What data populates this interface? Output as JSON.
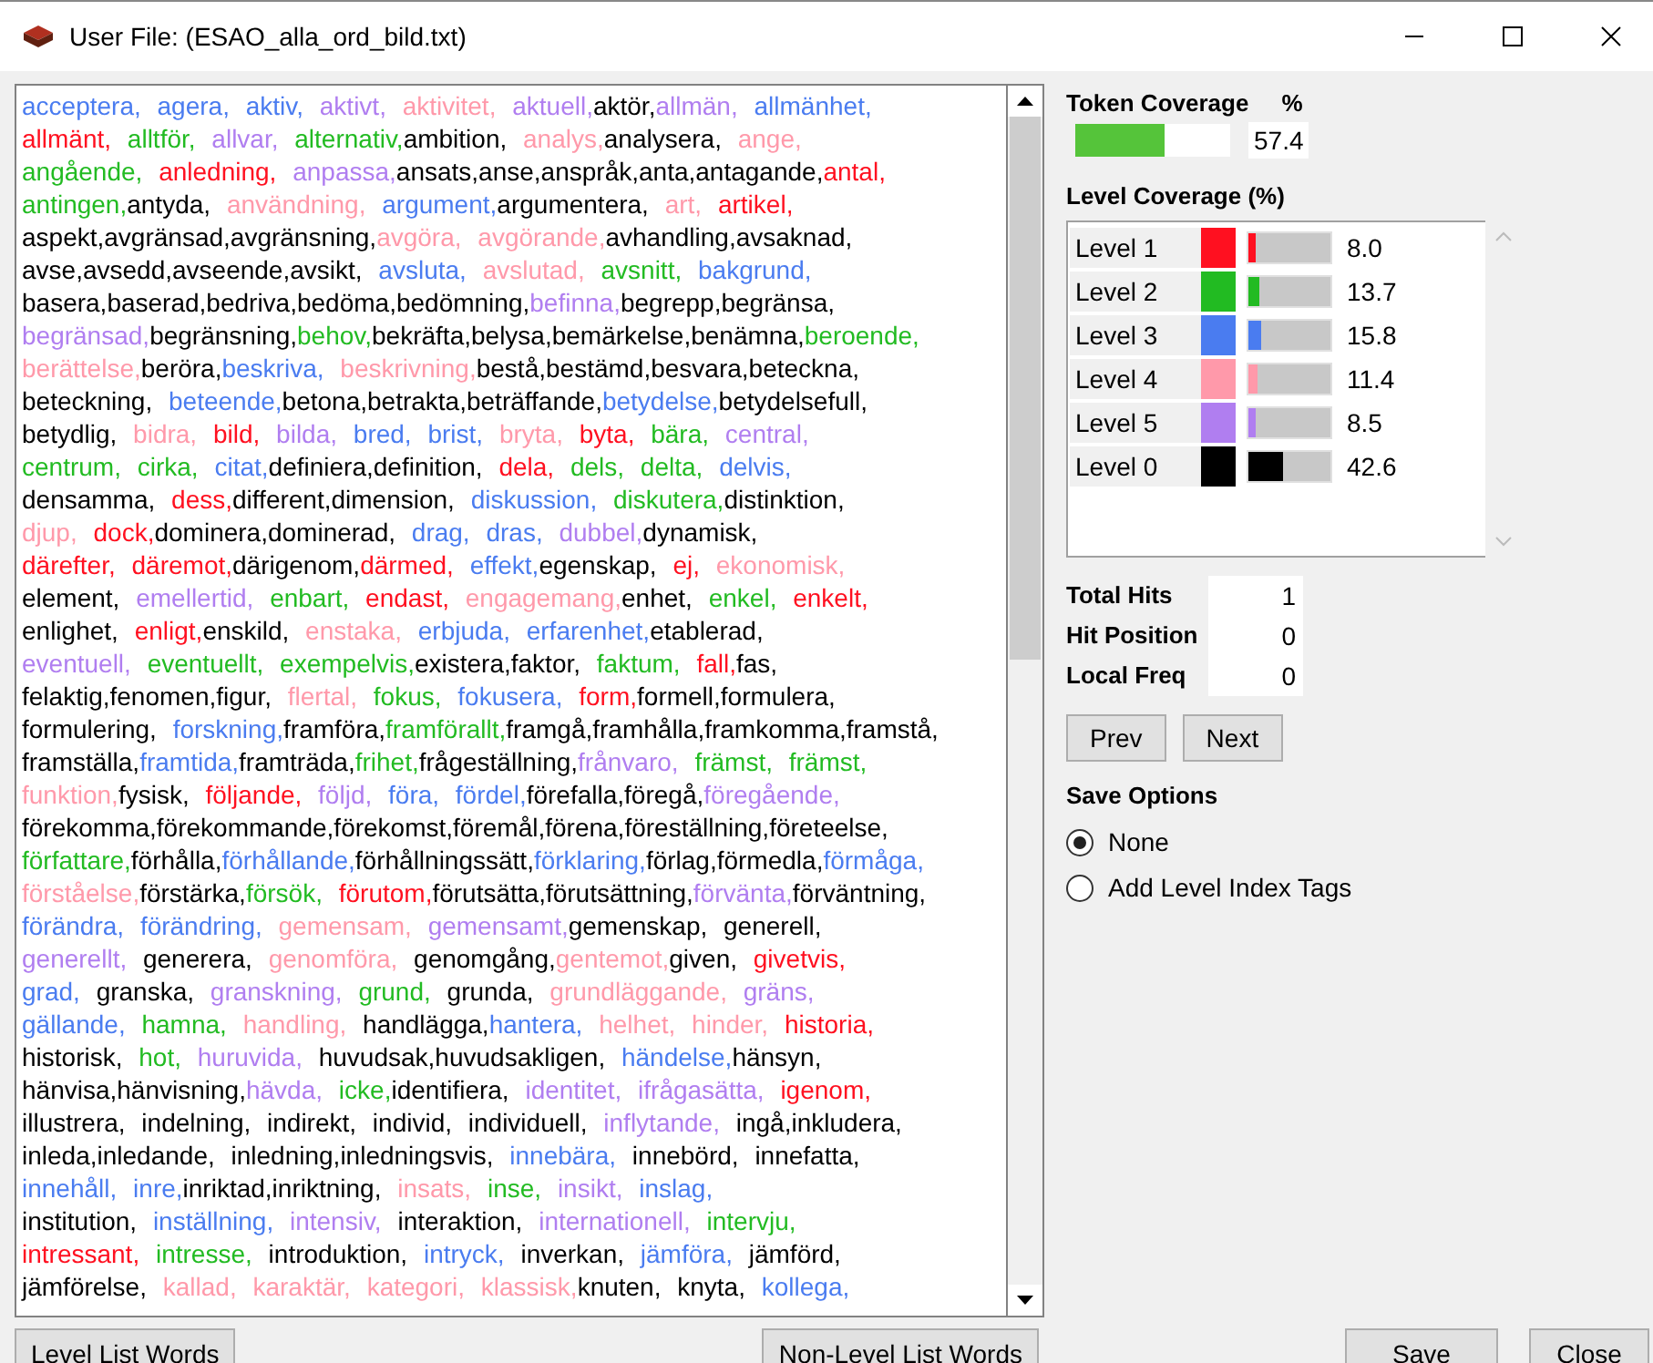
{
  "window": {
    "title": "User File: (ESAO_alla_ord_bild.txt)"
  },
  "words": {
    "lines": [
      [
        {
          "w": "acceptera, ",
          "color": "#4a7cf0"
        },
        {
          "w": "agera, ",
          "color": "#4a7cf0"
        },
        {
          "w": "aktiv, ",
          "color": "#4a7cf0"
        },
        {
          "w": "aktivt, ",
          "color": "#b07ef0"
        },
        {
          "w": "aktivitet, ",
          "color": "#ff99aa"
        },
        {
          "w": "aktuell,",
          "color": "#b07ef0"
        },
        {
          "w": "aktör,",
          "color": "#000000"
        },
        {
          "w": "allmän, ",
          "color": "#b07ef0"
        },
        {
          "w": "allmänhet,",
          "color": "#4a7cf0"
        }
      ],
      [
        {
          "w": "allmänt, ",
          "color": "#ff1020"
        },
        {
          "w": "alltför, ",
          "color": "#22bb22"
        },
        {
          "w": "allvar, ",
          "color": "#b07ef0"
        },
        {
          "w": "alternativ,",
          "color": "#22bb22"
        },
        {
          "w": "ambition, ",
          "color": "#000000"
        },
        {
          "w": "analys,",
          "color": "#ff99aa"
        },
        {
          "w": "analysera, ",
          "color": "#000000"
        },
        {
          "w": "ange,",
          "color": "#ff99aa"
        }
      ],
      [
        {
          "w": "angående, ",
          "color": "#22bb22"
        },
        {
          "w": "anledning, ",
          "color": "#ff1020"
        },
        {
          "w": "anpassa,",
          "color": "#b07ef0"
        },
        {
          "w": "ansats,anse,anspråk,anta,antagande,",
          "color": "#000000"
        },
        {
          "w": "antal,",
          "color": "#ff1020"
        }
      ],
      [
        {
          "w": "antingen,",
          "color": "#22bb22"
        },
        {
          "w": "antyda, ",
          "color": "#000000"
        },
        {
          "w": "användning, ",
          "color": "#ff99aa"
        },
        {
          "w": "argument,",
          "color": "#4a7cf0"
        },
        {
          "w": "argumentera, ",
          "color": "#000000"
        },
        {
          "w": "art, ",
          "color": "#ff99aa"
        },
        {
          "w": "artikel,",
          "color": "#ff1020"
        }
      ],
      [
        {
          "w": "aspekt,avgränsad,avgränsning,",
          "color": "#000000"
        },
        {
          "w": "avgöra, ",
          "color": "#ff99aa"
        },
        {
          "w": "avgörande,",
          "color": "#ff99aa"
        },
        {
          "w": "avhandling,avsaknad,",
          "color": "#000000"
        }
      ],
      [
        {
          "w": "avse,avsedd,avseende,avsikt, ",
          "color": "#000000"
        },
        {
          "w": "avsluta, ",
          "color": "#4a7cf0"
        },
        {
          "w": "avslutad, ",
          "color": "#ff99aa"
        },
        {
          "w": "avsnitt, ",
          "color": "#22bb22"
        },
        {
          "w": "bakgrund,",
          "color": "#4a7cf0"
        }
      ],
      [
        {
          "w": "basera,baserad,bedriva,bedöma,bedömning,",
          "color": "#000000"
        },
        {
          "w": "befinna,",
          "color": "#b07ef0"
        },
        {
          "w": "begrepp,begränsa,",
          "color": "#000000"
        }
      ],
      [
        {
          "w": "begränsad,",
          "color": "#b07ef0"
        },
        {
          "w": "begränsning,",
          "color": "#000000"
        },
        {
          "w": "behov,",
          "color": "#22bb22"
        },
        {
          "w": "bekräfta,belysa,bemärkelse,benämna,",
          "color": "#000000"
        },
        {
          "w": "beroende,",
          "color": "#22bb22"
        }
      ],
      [
        {
          "w": "berättelse,",
          "color": "#ff99aa"
        },
        {
          "w": "beröra,",
          "color": "#000000"
        },
        {
          "w": "beskriva, ",
          "color": "#4a7cf0"
        },
        {
          "w": "beskrivning,",
          "color": "#ff99aa"
        },
        {
          "w": "bestå,bestämd,besvara,beteckna,",
          "color": "#000000"
        }
      ],
      [
        {
          "w": "beteckning, ",
          "color": "#000000"
        },
        {
          "w": "beteende,",
          "color": "#4a7cf0"
        },
        {
          "w": "betona,betrakta,beträffande,",
          "color": "#000000"
        },
        {
          "w": "betydelse,",
          "color": "#4a7cf0"
        },
        {
          "w": "betydelsefull,",
          "color": "#000000"
        }
      ],
      [
        {
          "w": "betydlig, ",
          "color": "#000000"
        },
        {
          "w": "bidra, ",
          "color": "#ff99aa"
        },
        {
          "w": "bild, ",
          "color": "#ff1020"
        },
        {
          "w": "bilda, ",
          "color": "#b07ef0"
        },
        {
          "w": "bred, ",
          "color": "#4a7cf0"
        },
        {
          "w": "brist, ",
          "color": "#4a7cf0"
        },
        {
          "w": "bryta, ",
          "color": "#ff99aa"
        },
        {
          "w": "byta, ",
          "color": "#ff1020"
        },
        {
          "w": "bära, ",
          "color": "#22bb22"
        },
        {
          "w": "central,",
          "color": "#b07ef0"
        }
      ],
      [
        {
          "w": "centrum, ",
          "color": "#22bb22"
        },
        {
          "w": "cirka, ",
          "color": "#22bb22"
        },
        {
          "w": "citat,",
          "color": "#4a7cf0"
        },
        {
          "w": "definiera,definition, ",
          "color": "#000000"
        },
        {
          "w": "dela, ",
          "color": "#ff1020"
        },
        {
          "w": "dels, ",
          "color": "#22bb22"
        },
        {
          "w": "delta, ",
          "color": "#22bb22"
        },
        {
          "w": "delvis,",
          "color": "#4a7cf0"
        }
      ],
      [
        {
          "w": "densamma, ",
          "color": "#000000"
        },
        {
          "w": "dess,",
          "color": "#ff1020"
        },
        {
          "w": "different,dimension, ",
          "color": "#000000"
        },
        {
          "w": "diskussion, ",
          "color": "#4a7cf0"
        },
        {
          "w": "diskutera,",
          "color": "#22bb22"
        },
        {
          "w": "distinktion,",
          "color": "#000000"
        }
      ],
      [
        {
          "w": "djup, ",
          "color": "#ff99aa"
        },
        {
          "w": "dock,",
          "color": "#ff1020"
        },
        {
          "w": "dominera,dominerad, ",
          "color": "#000000"
        },
        {
          "w": "drag, ",
          "color": "#4a7cf0"
        },
        {
          "w": "dras, ",
          "color": "#4a7cf0"
        },
        {
          "w": "dubbel,",
          "color": "#b07ef0"
        },
        {
          "w": "dynamisk,",
          "color": "#000000"
        }
      ],
      [
        {
          "w": "därefter, ",
          "color": "#ff1020"
        },
        {
          "w": "däremot,",
          "color": "#ff1020"
        },
        {
          "w": "därigenom,",
          "color": "#000000"
        },
        {
          "w": "därmed, ",
          "color": "#ff1020"
        },
        {
          "w": "effekt,",
          "color": "#4a7cf0"
        },
        {
          "w": "egenskap, ",
          "color": "#000000"
        },
        {
          "w": "ej, ",
          "color": "#ff1020"
        },
        {
          "w": "ekonomisk,",
          "color": "#ff99aa"
        }
      ],
      [
        {
          "w": "element, ",
          "color": "#000000"
        },
        {
          "w": "emellertid, ",
          "color": "#b07ef0"
        },
        {
          "w": "enbart, ",
          "color": "#22bb22"
        },
        {
          "w": "endast, ",
          "color": "#ff1020"
        },
        {
          "w": "engagemang,",
          "color": "#ff99aa"
        },
        {
          "w": "enhet, ",
          "color": "#000000"
        },
        {
          "w": "enkel, ",
          "color": "#22bb22"
        },
        {
          "w": "enkelt,",
          "color": "#ff1020"
        }
      ],
      [
        {
          "w": "enlighet, ",
          "color": "#000000"
        },
        {
          "w": "enligt,",
          "color": "#ff1020"
        },
        {
          "w": "enskild, ",
          "color": "#000000"
        },
        {
          "w": "enstaka, ",
          "color": "#ff99aa"
        },
        {
          "w": "erbjuda, ",
          "color": "#4a7cf0"
        },
        {
          "w": "erfarenhet,",
          "color": "#4a7cf0"
        },
        {
          "w": "etablerad,",
          "color": "#000000"
        }
      ],
      [
        {
          "w": "eventuell, ",
          "color": "#b07ef0"
        },
        {
          "w": "eventuellt, ",
          "color": "#22bb22"
        },
        {
          "w": "exempelvis,",
          "color": "#22bb22"
        },
        {
          "w": "existera,faktor, ",
          "color": "#000000"
        },
        {
          "w": "faktum, ",
          "color": "#22bb22"
        },
        {
          "w": "fall,",
          "color": "#ff1020"
        },
        {
          "w": "fas,",
          "color": "#000000"
        }
      ],
      [
        {
          "w": "felaktig,fenomen,figur, ",
          "color": "#000000"
        },
        {
          "w": "flertal, ",
          "color": "#ff99aa"
        },
        {
          "w": "fokus, ",
          "color": "#22bb22"
        },
        {
          "w": "fokusera, ",
          "color": "#4a7cf0"
        },
        {
          "w": "form,",
          "color": "#ff1020"
        },
        {
          "w": "formell,formulera,",
          "color": "#000000"
        }
      ],
      [
        {
          "w": "formulering, ",
          "color": "#000000"
        },
        {
          "w": "forskning,",
          "color": "#4a7cf0"
        },
        {
          "w": "framföra,",
          "color": "#000000"
        },
        {
          "w": "framförallt,",
          "color": "#22bb22"
        },
        {
          "w": "framgå,framhålla,framkomma,framstå,",
          "color": "#000000"
        }
      ],
      [
        {
          "w": "framställa,",
          "color": "#000000"
        },
        {
          "w": "framtida,",
          "color": "#4a7cf0"
        },
        {
          "w": "framträda,",
          "color": "#000000"
        },
        {
          "w": "frihet,",
          "color": "#22bb22"
        },
        {
          "w": "frågeställning,",
          "color": "#000000"
        },
        {
          "w": "frånvaro, ",
          "color": "#b07ef0"
        },
        {
          "w": "främst, ",
          "color": "#22bb22"
        },
        {
          "w": "främst,",
          "color": "#22bb22"
        }
      ],
      [
        {
          "w": "funktion,",
          "color": "#ff99aa"
        },
        {
          "w": "fysisk, ",
          "color": "#000000"
        },
        {
          "w": "följande, ",
          "color": "#ff1020"
        },
        {
          "w": "följd, ",
          "color": "#b07ef0"
        },
        {
          "w": "föra, ",
          "color": "#4a7cf0"
        },
        {
          "w": "fördel,",
          "color": "#4a7cf0"
        },
        {
          "w": "förefalla,föregå,",
          "color": "#000000"
        },
        {
          "w": "föregående,",
          "color": "#b07ef0"
        }
      ],
      [
        {
          "w": "förekomma,förekommande,förekomst,föremål,förena,föreställning,företeelse,",
          "color": "#000000"
        }
      ],
      [
        {
          "w": "författare,",
          "color": "#22bb22"
        },
        {
          "w": "förhålla,",
          "color": "#000000"
        },
        {
          "w": "förhållande,",
          "color": "#4a7cf0"
        },
        {
          "w": "förhållningssätt,",
          "color": "#000000"
        },
        {
          "w": "förklaring,",
          "color": "#4a7cf0"
        },
        {
          "w": "förlag,förmedla,",
          "color": "#000000"
        },
        {
          "w": "förmåga,",
          "color": "#4a7cf0"
        }
      ],
      [
        {
          "w": "förståelse,",
          "color": "#ff99aa"
        },
        {
          "w": "förstärka,",
          "color": "#000000"
        },
        {
          "w": "försök, ",
          "color": "#22bb22"
        },
        {
          "w": "förutom,",
          "color": "#ff1020"
        },
        {
          "w": "förutsätta,förutsättning,",
          "color": "#000000"
        },
        {
          "w": "förvänta,",
          "color": "#b07ef0"
        },
        {
          "w": "förväntning,",
          "color": "#000000"
        }
      ],
      [
        {
          "w": "förändra, ",
          "color": "#4a7cf0"
        },
        {
          "w": "förändring, ",
          "color": "#4a7cf0"
        },
        {
          "w": "gemensam, ",
          "color": "#ff99aa"
        },
        {
          "w": "gemensamt,",
          "color": "#b07ef0"
        },
        {
          "w": "gemenskap, generell,",
          "color": "#000000"
        }
      ],
      [
        {
          "w": "generellt, ",
          "color": "#b07ef0"
        },
        {
          "w": "generera, ",
          "color": "#000000"
        },
        {
          "w": "genomföra, ",
          "color": "#ff99aa"
        },
        {
          "w": "genomgång,",
          "color": "#000000"
        },
        {
          "w": "gentemot,",
          "color": "#ff99aa"
        },
        {
          "w": "given, ",
          "color": "#000000"
        },
        {
          "w": "givetvis,",
          "color": "#ff1020"
        }
      ],
      [
        {
          "w": "grad, ",
          "color": "#4a7cf0"
        },
        {
          "w": "granska, ",
          "color": "#000000"
        },
        {
          "w": "granskning, ",
          "color": "#b07ef0"
        },
        {
          "w": "grund, ",
          "color": "#22bb22"
        },
        {
          "w": "grunda, ",
          "color": "#000000"
        },
        {
          "w": "grundläggande, ",
          "color": "#ff99aa"
        },
        {
          "w": "gräns,",
          "color": "#b07ef0"
        }
      ],
      [
        {
          "w": "gällande, ",
          "color": "#4a7cf0"
        },
        {
          "w": "hamna, ",
          "color": "#22bb22"
        },
        {
          "w": "handling, ",
          "color": "#ff99aa"
        },
        {
          "w": "handlägga,",
          "color": "#000000"
        },
        {
          "w": "hantera, ",
          "color": "#4a7cf0"
        },
        {
          "w": "helhet, ",
          "color": "#ff99aa"
        },
        {
          "w": "hinder, ",
          "color": "#ff99aa"
        },
        {
          "w": "historia,",
          "color": "#ff1020"
        }
      ],
      [
        {
          "w": "historisk, ",
          "color": "#000000"
        },
        {
          "w": "hot, ",
          "color": "#22bb22"
        },
        {
          "w": "huruvida, ",
          "color": "#b07ef0"
        },
        {
          "w": "huvudsak,huvudsakligen, ",
          "color": "#000000"
        },
        {
          "w": "händelse,",
          "color": "#4a7cf0"
        },
        {
          "w": "hänsyn,",
          "color": "#000000"
        }
      ],
      [
        {
          "w": "hänvisa,hänvisning,",
          "color": "#000000"
        },
        {
          "w": "hävda, ",
          "color": "#b07ef0"
        },
        {
          "w": "icke,",
          "color": "#22bb22"
        },
        {
          "w": "identifiera, ",
          "color": "#000000"
        },
        {
          "w": "identitet, ",
          "color": "#b07ef0"
        },
        {
          "w": "ifrågasätta, ",
          "color": "#b07ef0"
        },
        {
          "w": "igenom,",
          "color": "#ff1020"
        }
      ],
      [
        {
          "w": "illustrera, indelning, indirekt, individ, individuell, ",
          "color": "#000000"
        },
        {
          "w": "inflytande, ",
          "color": "#b07ef0"
        },
        {
          "w": "ingå,inkludera,",
          "color": "#000000"
        }
      ],
      [
        {
          "w": "inleda,inledande, inledning,inledningsvis, ",
          "color": "#000000"
        },
        {
          "w": "innebära, ",
          "color": "#4a7cf0"
        },
        {
          "w": "innebörd, innefatta,",
          "color": "#000000"
        }
      ],
      [
        {
          "w": "innehåll, ",
          "color": "#4a7cf0"
        },
        {
          "w": "inre,",
          "color": "#4a7cf0"
        },
        {
          "w": "inriktad,inriktning, ",
          "color": "#000000"
        },
        {
          "w": "insats, ",
          "color": "#ff99aa"
        },
        {
          "w": "inse, ",
          "color": "#22bb22"
        },
        {
          "w": "insikt, ",
          "color": "#b07ef0"
        },
        {
          "w": "inslag,",
          "color": "#4a7cf0"
        }
      ],
      [
        {
          "w": "institution, ",
          "color": "#000000"
        },
        {
          "w": "inställning, ",
          "color": "#4a7cf0"
        },
        {
          "w": "intensiv, ",
          "color": "#b07ef0"
        },
        {
          "w": "interaktion, ",
          "color": "#000000"
        },
        {
          "w": "internationell, ",
          "color": "#b07ef0"
        },
        {
          "w": "intervju,",
          "color": "#22bb22"
        }
      ],
      [
        {
          "w": "intressant, ",
          "color": "#ff1020"
        },
        {
          "w": "intresse, ",
          "color": "#22bb22"
        },
        {
          "w": "introduktion, ",
          "color": "#000000"
        },
        {
          "w": "intryck, ",
          "color": "#4a7cf0"
        },
        {
          "w": "inverkan, ",
          "color": "#000000"
        },
        {
          "w": "jämföra, ",
          "color": "#4a7cf0"
        },
        {
          "w": "jämförd,",
          "color": "#000000"
        }
      ],
      [
        {
          "w": "jämförelse, ",
          "color": "#000000"
        },
        {
          "w": "kallad, ",
          "color": "#ff99aa"
        },
        {
          "w": "karaktär, ",
          "color": "#ff99aa"
        },
        {
          "w": "kategori, ",
          "color": "#ff99aa"
        },
        {
          "w": "klassisk,",
          "color": "#ff99aa"
        },
        {
          "w": "knuten, knyta, ",
          "color": "#000000"
        },
        {
          "w": "kollega,",
          "color": "#4a7cf0"
        }
      ]
    ]
  },
  "token_coverage": {
    "label": "Token Coverage",
    "unit": "%",
    "level": 0.574,
    "value": "57.4"
  },
  "level_coverage": {
    "title": "Level Coverage (%)",
    "levels": [
      {
        "name": "Level 1",
        "color": "#ff1020",
        "level": 0.08,
        "value": "8.0"
      },
      {
        "name": "Level 2",
        "color": "#22bb22",
        "level": 0.137,
        "value": "13.7"
      },
      {
        "name": "Level 3",
        "color": "#4a7cf0",
        "level": 0.158,
        "value": "15.8"
      },
      {
        "name": "Level 4",
        "color": "#ff99aa",
        "level": 0.114,
        "value": "11.4"
      },
      {
        "name": "Level 5",
        "color": "#b07ef0",
        "level": 0.085,
        "value": "8.5"
      },
      {
        "name": "Level 0",
        "color": "#000000",
        "level": 0.426,
        "value": "42.6"
      }
    ]
  },
  "stats": [
    {
      "label": "Total Hits",
      "value": "1"
    },
    {
      "label": "Hit Position",
      "value": "0"
    },
    {
      "label": "Local Freq",
      "value": "0"
    }
  ],
  "nav_buttons": [
    "Prev",
    "Next"
  ],
  "save_options": {
    "title": "Save Options",
    "options": [
      {
        "label": "None",
        "selected": true
      },
      {
        "label": "Add Level Index Tags",
        "selected": false
      }
    ]
  },
  "bottom_buttons": {
    "left": [
      "Level List Words",
      "Non-Level List Words"
    ],
    "right": [
      "Save",
      "Close"
    ]
  }
}
